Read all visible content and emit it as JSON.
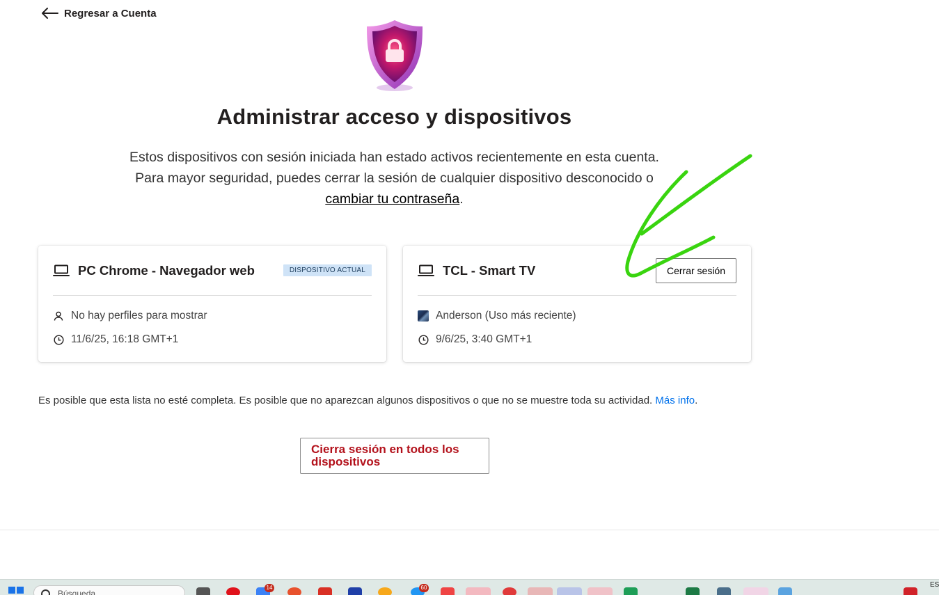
{
  "nav": {
    "back_label": "Regresar a Cuenta"
  },
  "page": {
    "title": "Administrar acceso y dispositivos",
    "description_text": "Estos dispositivos con sesión iniciada han estado activos recientemente en esta cuenta. Para mayor seguridad, puedes cerrar la sesión de cualquier dispositivo desconocido o ",
    "description_link": "cambiar tu contraseña",
    "description_end": "."
  },
  "devices": [
    {
      "name": "PC Chrome - Navegador web",
      "badge": "DISPOSITIVO ACTUAL",
      "profile": "No hay perfiles para mostrar",
      "last_active": "11/6/25, 16:18 GMT+1",
      "icon": "laptop-icon"
    },
    {
      "name": "TCL - Smart TV",
      "action_label": "Cerrar sesión",
      "profile": "Anderson (Uso más reciente)",
      "last_active": "9/6/25, 3:40 GMT+1",
      "icon": "laptop-icon"
    }
  ],
  "disclaimer": {
    "text": "Es posible que esta lista no esté completa. Es posible que no aparezcan algunos dispositivos o que no se muestre toda su actividad. ",
    "link": "Más info",
    "end": "."
  },
  "signout_all_label": "Cierra sesión en todos los dispositivos",
  "taskbar": {
    "search_placeholder": "Búsqueda",
    "language": "ES",
    "badges": [
      "14",
      "60"
    ]
  },
  "colors": {
    "accent_red": "#b3111b",
    "link_blue": "#0071eb",
    "badge_bg": "#cfe3f7",
    "annotation_green": "#39d40f"
  }
}
